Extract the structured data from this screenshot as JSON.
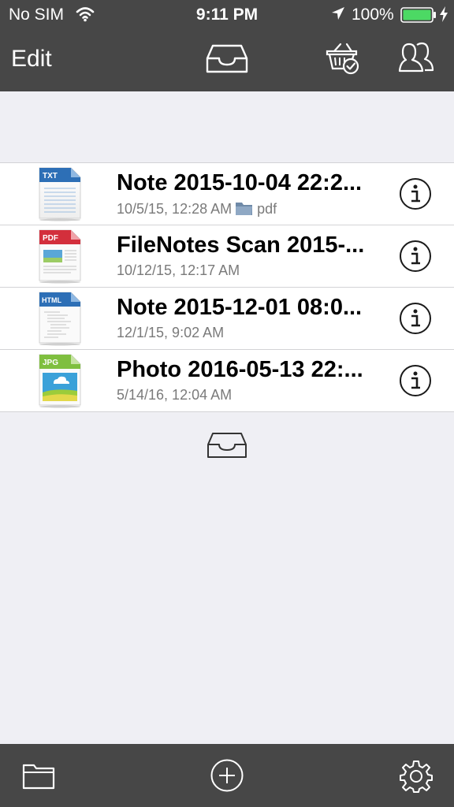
{
  "status_bar": {
    "carrier": "No SIM",
    "time": "9:11 PM",
    "battery_percent": "100%",
    "icons": [
      "wifi-icon",
      "location-arrow-icon",
      "battery-icon",
      "charging-bolt-icon"
    ]
  },
  "nav_bar": {
    "edit_label": "Edit",
    "icons": [
      "inbox-tray-icon",
      "basket-check-icon",
      "users-icon"
    ]
  },
  "files": [
    {
      "type_label": "TXT",
      "type_color": "#2d6fb6",
      "title": "Note 2015-10-04 22:2...",
      "subtitle": "10/5/15, 12:28 AM",
      "folder_label": "pdf",
      "icon": "txt-file-icon"
    },
    {
      "type_label": "PDF",
      "type_color": "#d32f3c",
      "title": "FileNotes Scan 2015-...",
      "subtitle": "10/12/15, 12:17 AM",
      "folder_label": "",
      "icon": "pdf-file-icon"
    },
    {
      "type_label": "HTML",
      "type_color": "#2d6fb6",
      "title": "Note 2015-12-01 08:0...",
      "subtitle": "12/1/15, 9:02 AM",
      "folder_label": "",
      "icon": "html-file-icon"
    },
    {
      "type_label": "JPG",
      "type_color": "#7fbf3f",
      "title": "Photo 2016-05-13 22:...",
      "subtitle": "5/14/16, 12:04 AM",
      "folder_label": "",
      "icon": "jpg-file-icon"
    }
  ],
  "bottom_bar": {
    "icons": [
      "folder-icon",
      "add-circle-icon",
      "settings-gear-icon"
    ]
  },
  "colors": {
    "bar_background": "#474747",
    "page_background": "#efeff4",
    "list_background": "#ffffff",
    "separator": "#d3d3d6",
    "battery_green": "#4cd964"
  }
}
